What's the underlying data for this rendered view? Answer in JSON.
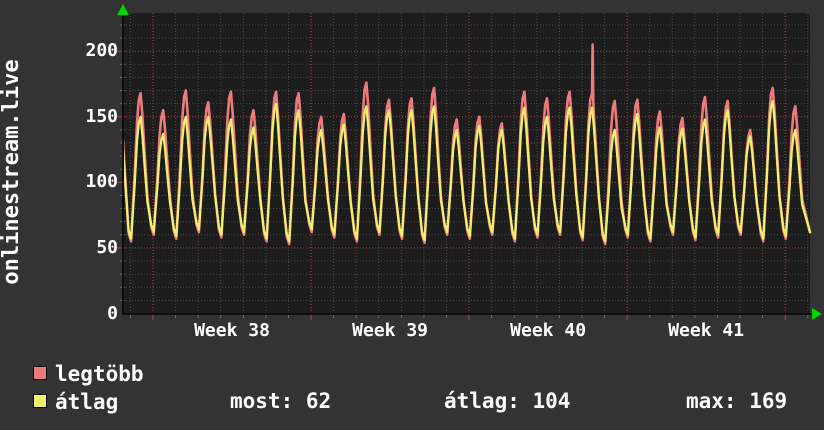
{
  "side_label": "onlinestream.live",
  "colors": {
    "background": "#333333",
    "plot_background": "#1d1d1d",
    "grid_minor": "#4c4c4c",
    "grid_major": "#a84444",
    "axis": "#0d0d0d",
    "arrow": "#00d400",
    "text": "#ffffff",
    "series_max": "#ee7b7b",
    "series_avg": "#f0f06e"
  },
  "legend": [
    {
      "label": "legtöbb",
      "color": "#ee7b7b"
    },
    {
      "label": "átlag",
      "color": "#f0f06e"
    }
  ],
  "stats": [
    {
      "label": "most",
      "value": "62",
      "text": "most: 62"
    },
    {
      "label": "átlag",
      "value": "104",
      "text": "átlag: 104"
    },
    {
      "label": "max",
      "value": "169",
      "text": "max: 169"
    }
  ],
  "chart_data": {
    "type": "line",
    "title": "",
    "xlabel": "",
    "ylabel": "",
    "x_span_days": 30.43,
    "week_boundaries_t": [
      1.33,
      8.33,
      15.33,
      22.33,
      29.33
    ],
    "day_grid_start_t": 0.33,
    "x_tick_labels": [
      {
        "text": "Week 38",
        "t_center": 4.83
      },
      {
        "text": "Week 39",
        "t_center": 11.83
      },
      {
        "text": "Week 40",
        "t_center": 18.83
      },
      {
        "text": "Week 41",
        "t_center": 25.83
      }
    ],
    "y_axis": {
      "major_ticks": [
        0,
        50,
        100,
        150,
        200
      ],
      "minor_step": 10,
      "ylim": [
        0,
        229.5
      ]
    },
    "legend_position": "bottom-left",
    "grid": true,
    "series_meta": [
      {
        "name": "legtöbb",
        "role": "max",
        "color": "#ee7b7b"
      },
      {
        "name": "átlag",
        "role": "avg",
        "color": "#f0f06e"
      }
    ],
    "edge_start": {
      "max": 132,
      "avg": 124
    },
    "edge_end_value": 62,
    "spike": {
      "day_index": 20,
      "value": 205
    },
    "days": [
      {
        "max": 168,
        "avg": 150,
        "low": 55
      },
      {
        "max": 155,
        "avg": 137,
        "low": 60
      },
      {
        "max": 170,
        "avg": 150,
        "low": 57
      },
      {
        "max": 161,
        "avg": 150,
        "low": 62
      },
      {
        "max": 169,
        "avg": 148,
        "low": 58
      },
      {
        "max": 155,
        "avg": 142,
        "low": 60
      },
      {
        "max": 169,
        "avg": 160,
        "low": 55
      },
      {
        "max": 168,
        "avg": 155,
        "low": 53
      },
      {
        "max": 150,
        "avg": 140,
        "low": 62
      },
      {
        "max": 152,
        "avg": 144,
        "low": 58
      },
      {
        "max": 176,
        "avg": 158,
        "low": 55
      },
      {
        "max": 163,
        "avg": 155,
        "low": 60
      },
      {
        "max": 164,
        "avg": 155,
        "low": 57
      },
      {
        "max": 172,
        "avg": 158,
        "low": 54
      },
      {
        "max": 148,
        "avg": 140,
        "low": 60
      },
      {
        "max": 150,
        "avg": 143,
        "low": 57
      },
      {
        "max": 145,
        "avg": 140,
        "low": 60
      },
      {
        "max": 169,
        "avg": 157,
        "low": 55
      },
      {
        "max": 164,
        "avg": 150,
        "low": 58
      },
      {
        "max": 169,
        "avg": 157,
        "low": 60
      },
      {
        "max": 168,
        "avg": 157,
        "low": 56
      },
      {
        "max": 162,
        "avg": 140,
        "low": 53
      },
      {
        "max": 163,
        "avg": 152,
        "low": 58
      },
      {
        "max": 154,
        "avg": 142,
        "low": 55
      },
      {
        "max": 149,
        "avg": 141,
        "low": 60
      },
      {
        "max": 165,
        "avg": 148,
        "low": 56
      },
      {
        "max": 162,
        "avg": 155,
        "low": 58
      },
      {
        "max": 140,
        "avg": 135,
        "low": 60
      },
      {
        "max": 172,
        "avg": 162,
        "low": 55
      },
      {
        "max": 158,
        "avg": 140,
        "low": 57
      }
    ]
  }
}
